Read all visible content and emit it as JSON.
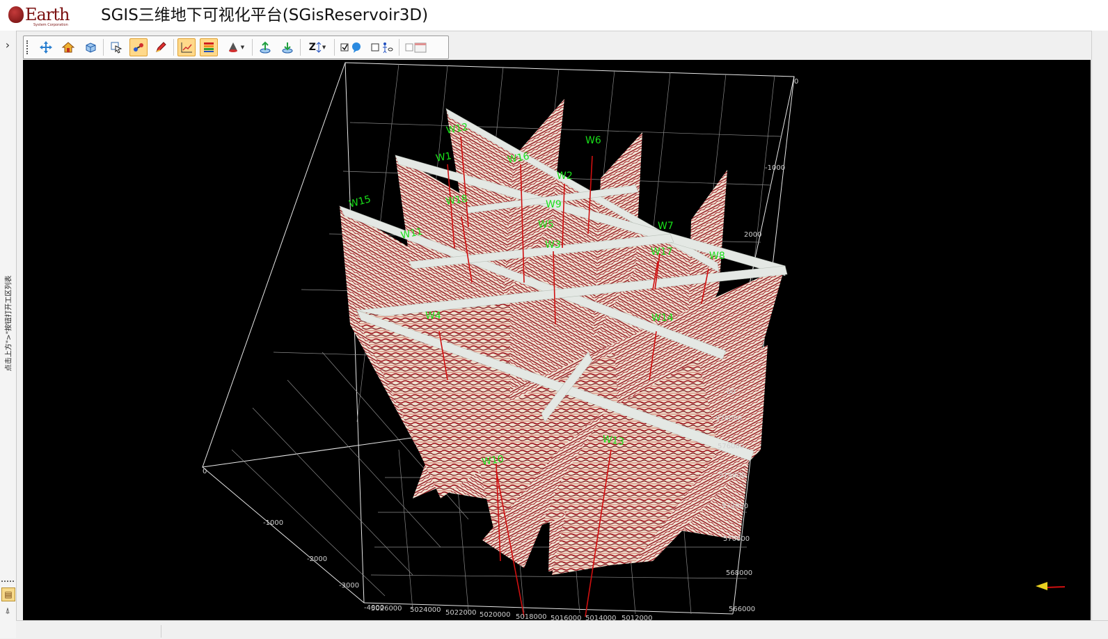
{
  "app": {
    "logo_text": "Earth",
    "logo_sub": "System Corporation",
    "title": "SGIS三维地下可视化平台(SGisReservoir3D)"
  },
  "left_panel": {
    "expand_glyph": "›",
    "vertical_text": "点击上方\">\"按钮打开工区列表"
  },
  "toolbar": {
    "buttons": [
      {
        "name": "pan-icon"
      },
      {
        "name": "home-icon"
      },
      {
        "name": "cube-view-icon"
      },
      {
        "name": "select-pointer-icon"
      },
      {
        "name": "link-nodes-icon"
      },
      {
        "name": "pen-draw-icon"
      },
      {
        "name": "axis-grid-icon",
        "active": true
      },
      {
        "name": "color-bars-icon",
        "active": true
      },
      {
        "name": "light-cone-icon"
      },
      {
        "name": "export-arrow-icon"
      },
      {
        "name": "import-arrow-icon"
      },
      {
        "name": "z-scale-icon",
        "label": "Z"
      },
      {
        "name": "checkbox-balloon-icon"
      },
      {
        "name": "checkbox-person-icon"
      },
      {
        "name": "checkbox-window-icon"
      }
    ]
  },
  "scene": {
    "colors": {
      "background": "#000000",
      "grid": "#e8e8e8",
      "seismic_dark": "#8b0a12",
      "seismic_light": "#f2e6d6",
      "cap": "#e4e8e4",
      "well_label": "#19e019",
      "well_trace": "#d01010"
    },
    "wells": [
      "W12",
      "W1",
      "W16",
      "W6",
      "W2",
      "W15",
      "W18",
      "W9",
      "W5",
      "W7",
      "W11",
      "W3",
      "W17",
      "W8",
      "W4",
      "W14",
      "W13",
      "W10"
    ],
    "depth_ticks": [
      "0",
      "-1000",
      "2000",
      "00"
    ],
    "left_depth_ticks": [
      "0",
      "-1000",
      "-2000",
      "-3000",
      "-4000"
    ],
    "y_ticks": [
      "578000",
      "576000",
      "574000",
      "572000",
      "570000",
      "568000",
      "566000"
    ],
    "x_ticks": [
      "5026000",
      "5024000",
      "5022000",
      "5020000",
      "5018000",
      "5016000",
      "5014000",
      "5012000"
    ]
  }
}
